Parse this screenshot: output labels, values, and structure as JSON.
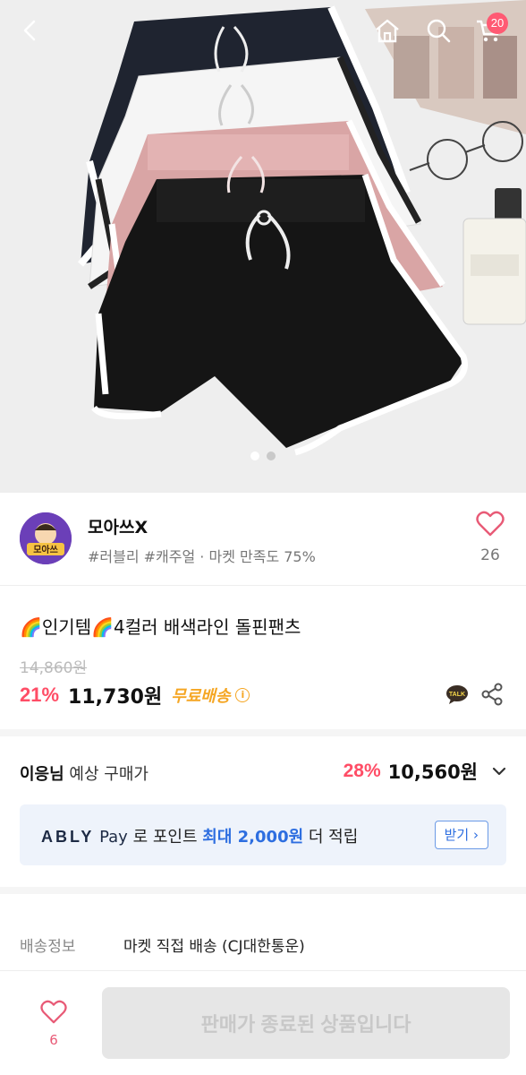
{
  "topbar": {
    "back_icon": "chevron-left-icon",
    "home_icon": "home-icon",
    "search_icon": "search-icon",
    "cart_icon": "cart-icon",
    "cart_count": "20"
  },
  "gallery": {
    "image": "product photo: four dolphin shorts in navy, white, pink and black with white trim",
    "page_count": 2,
    "active_page": 1
  },
  "seller": {
    "avatar_text": "모아쓰",
    "name": "모아쓰X",
    "tags": "#러블리 #캐주얼 · 마켓 만족도 75%",
    "like_count": "26"
  },
  "product": {
    "title": "🌈인기템🌈4컬러 배색라인 돌핀팬츠",
    "original_price": "14,860원",
    "discount": "21%",
    "price": "11,730원",
    "shipping_badge": "무료배송",
    "info_icon": "ⓘ"
  },
  "member_price": {
    "name": "이응님",
    "label": "예상 구매가",
    "discount": "28%",
    "price": "10,560원"
  },
  "ably_pay": {
    "brand": "ABLY",
    "pay": "Pay",
    "text_1": "로 포인트",
    "highlight": "최대 2,000원",
    "text_2": "더 적립",
    "button": "받기 ›"
  },
  "shipping": {
    "label": "배송정보",
    "value": "마켓 직접 배송 (CJ대한통운)"
  },
  "bottom_bar": {
    "like_count": "6",
    "buy_button": "판매가 종료된 상품입니다"
  },
  "colors": {
    "accent_red": "#ff4d66",
    "heart_pink": "#e85a76",
    "free_ship_orange": "#f5a623",
    "pay_blue": "#2d6ee0",
    "pay_bg": "#eef3fb",
    "disabled_bg": "#e6e6e6"
  }
}
